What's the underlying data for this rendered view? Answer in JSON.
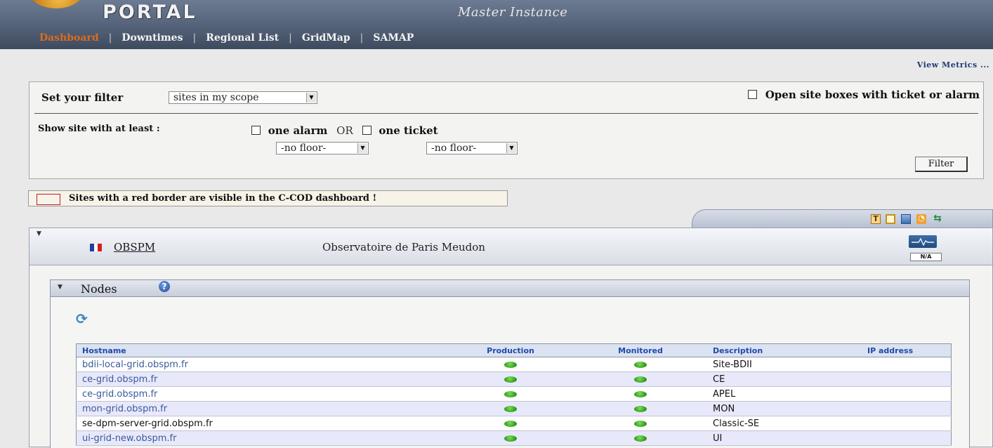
{
  "header": {
    "logo_text": "PORTAL",
    "instance": "Master Instance",
    "nav": [
      {
        "label": "Dashboard",
        "active": true
      },
      {
        "label": "Downtimes",
        "active": false
      },
      {
        "label": "Regional List",
        "active": false
      },
      {
        "label": "GridMap",
        "active": false
      },
      {
        "label": "SAMAP",
        "active": false
      }
    ]
  },
  "view_metrics": "View Metrics ...",
  "filter": {
    "label": "Set your filter",
    "scope_value": "sites in my scope",
    "open_boxes_label": "Open site boxes with ticket or alarm",
    "show_site_label": "Show site with at least :",
    "alarm_label": "one alarm",
    "or_label": "OR",
    "ticket_label": "one ticket",
    "alarm_floor": "-no floor-",
    "ticket_floor": "-no floor-",
    "button": "Filter"
  },
  "legend": "Sites with a red border are visible in the C-COD dashboard !",
  "toolbar_icons": [
    "ticket-add-icon",
    "notepad-icon",
    "contacts-icon",
    "rss-icon",
    "refresh-arrows-icon"
  ],
  "site": {
    "name": "OBSPM",
    "description": "Observatoire de Paris Meudon",
    "status": "N/A",
    "flag_colors": [
      "#1c3fa0",
      "#ffffff",
      "#d81c1c"
    ]
  },
  "nodes": {
    "title": "Nodes",
    "columns": [
      "Hostname",
      "Production",
      "Monitored",
      "Description",
      "IP address"
    ],
    "rows": [
      {
        "hostname": "bdii-local-grid.obspm.fr",
        "production": true,
        "monitored": true,
        "description": "Site-BDII",
        "ip": ""
      },
      {
        "hostname": "ce-grid.obspm.fr",
        "production": true,
        "monitored": true,
        "description": "CE",
        "ip": ""
      },
      {
        "hostname": "ce-grid.obspm.fr",
        "production": true,
        "monitored": true,
        "description": "APEL",
        "ip": ""
      },
      {
        "hostname": "mon-grid.obspm.fr",
        "production": true,
        "monitored": true,
        "description": "MON",
        "ip": ""
      },
      {
        "hostname": "se-dpm-server-grid.obspm.fr",
        "production": true,
        "monitored": true,
        "description": "Classic-SE",
        "ip": ""
      },
      {
        "hostname": "ui-grid-new.obspm.fr",
        "production": true,
        "monitored": true,
        "description": "UI",
        "ip": ""
      }
    ]
  },
  "colors": {
    "header_bg": "#56647b",
    "nav_active": "#d96d1c",
    "link_blue": "#1e3a78",
    "status_green": "#2e9a1a",
    "row_alt": "#e8e8fb"
  }
}
